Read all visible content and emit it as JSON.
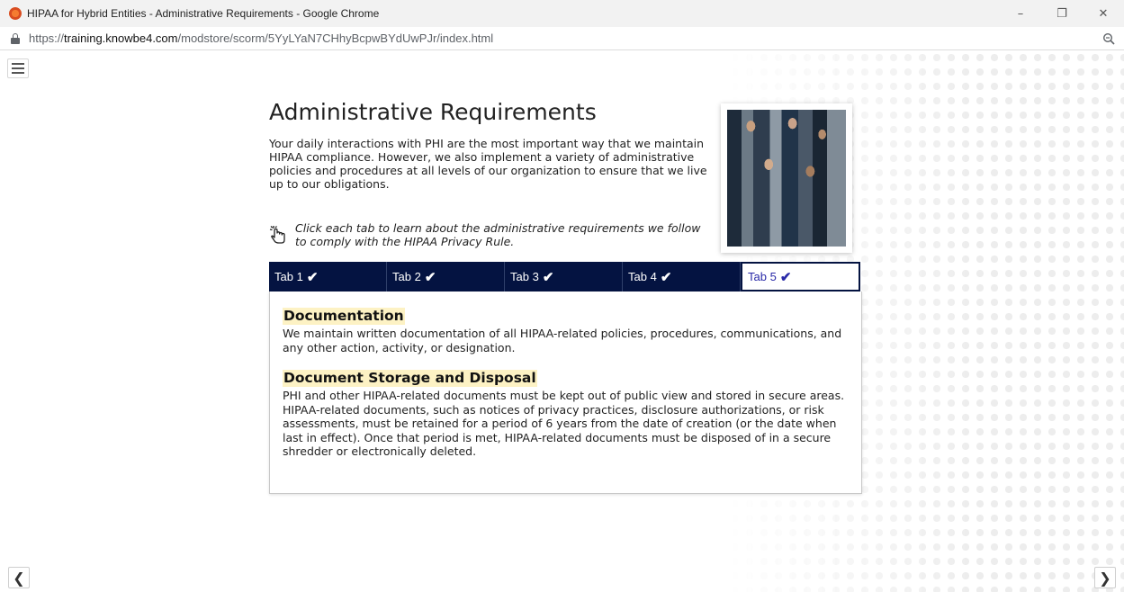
{
  "window": {
    "title": "HIPAA for Hybrid Entities - Administrative Requirements - Google Chrome",
    "controls": {
      "minimize": "–",
      "restore": "❐",
      "close": "✕"
    }
  },
  "address_bar": {
    "url_scheme": "https://",
    "url_host": "training.knowbe4.com",
    "url_path": "/modstore/scorm/5YyLYaN7CHhyBcpwBYdUwPJr/index.html"
  },
  "page": {
    "title": "Administrative Requirements",
    "intro": "Your daily interactions with PHI are the most important way that we maintain HIPAA compliance. However, we also implement a variety of administrative policies and procedures at all levels of our organization to ensure that we live up to our obligations.",
    "hint": "Click each tab to learn about the administrative requirements we follow to comply with the HIPAA Privacy Rule.",
    "tabs": [
      {
        "label": "Tab 1",
        "check": "✔"
      },
      {
        "label": "Tab 2",
        "check": "✔"
      },
      {
        "label": "Tab 3",
        "check": "✔"
      },
      {
        "label": "Tab 4",
        "check": "✔"
      },
      {
        "label": "Tab 5",
        "check": "✔"
      }
    ],
    "active_tab": "Tab 5",
    "sections": [
      {
        "heading": "Documentation",
        "body": "We maintain written documentation of all HIPAA-related policies, procedures, communications, and any other action, activity, or designation."
      },
      {
        "heading": "Document Storage and Disposal",
        "body": "PHI and other HIPAA-related documents must be kept out of public view and stored in secure areas. HIPAA-related documents, such as notices of privacy practices, disclosure authorizations, or risk assessments, must be retained for a period of 6 years from the date of creation (or the date when last in effect). Once that period is met, HIPAA-related documents must be disposed of in a secure shredder or electronically deleted."
      }
    ],
    "nav": {
      "prev": "❮",
      "next": "❯"
    }
  },
  "icons": {
    "app": "chrome-icon",
    "lock": "lock-icon",
    "zoom": "zoom-icon",
    "menu": "hamburger-menu-icon",
    "hint": "hand-pointer-click-icon",
    "check": "checkmark-icon"
  },
  "colors": {
    "tab_bar": "#041341",
    "active_tab_text": "#2a2aa8",
    "heading_highlight": "#fdf2c4"
  }
}
